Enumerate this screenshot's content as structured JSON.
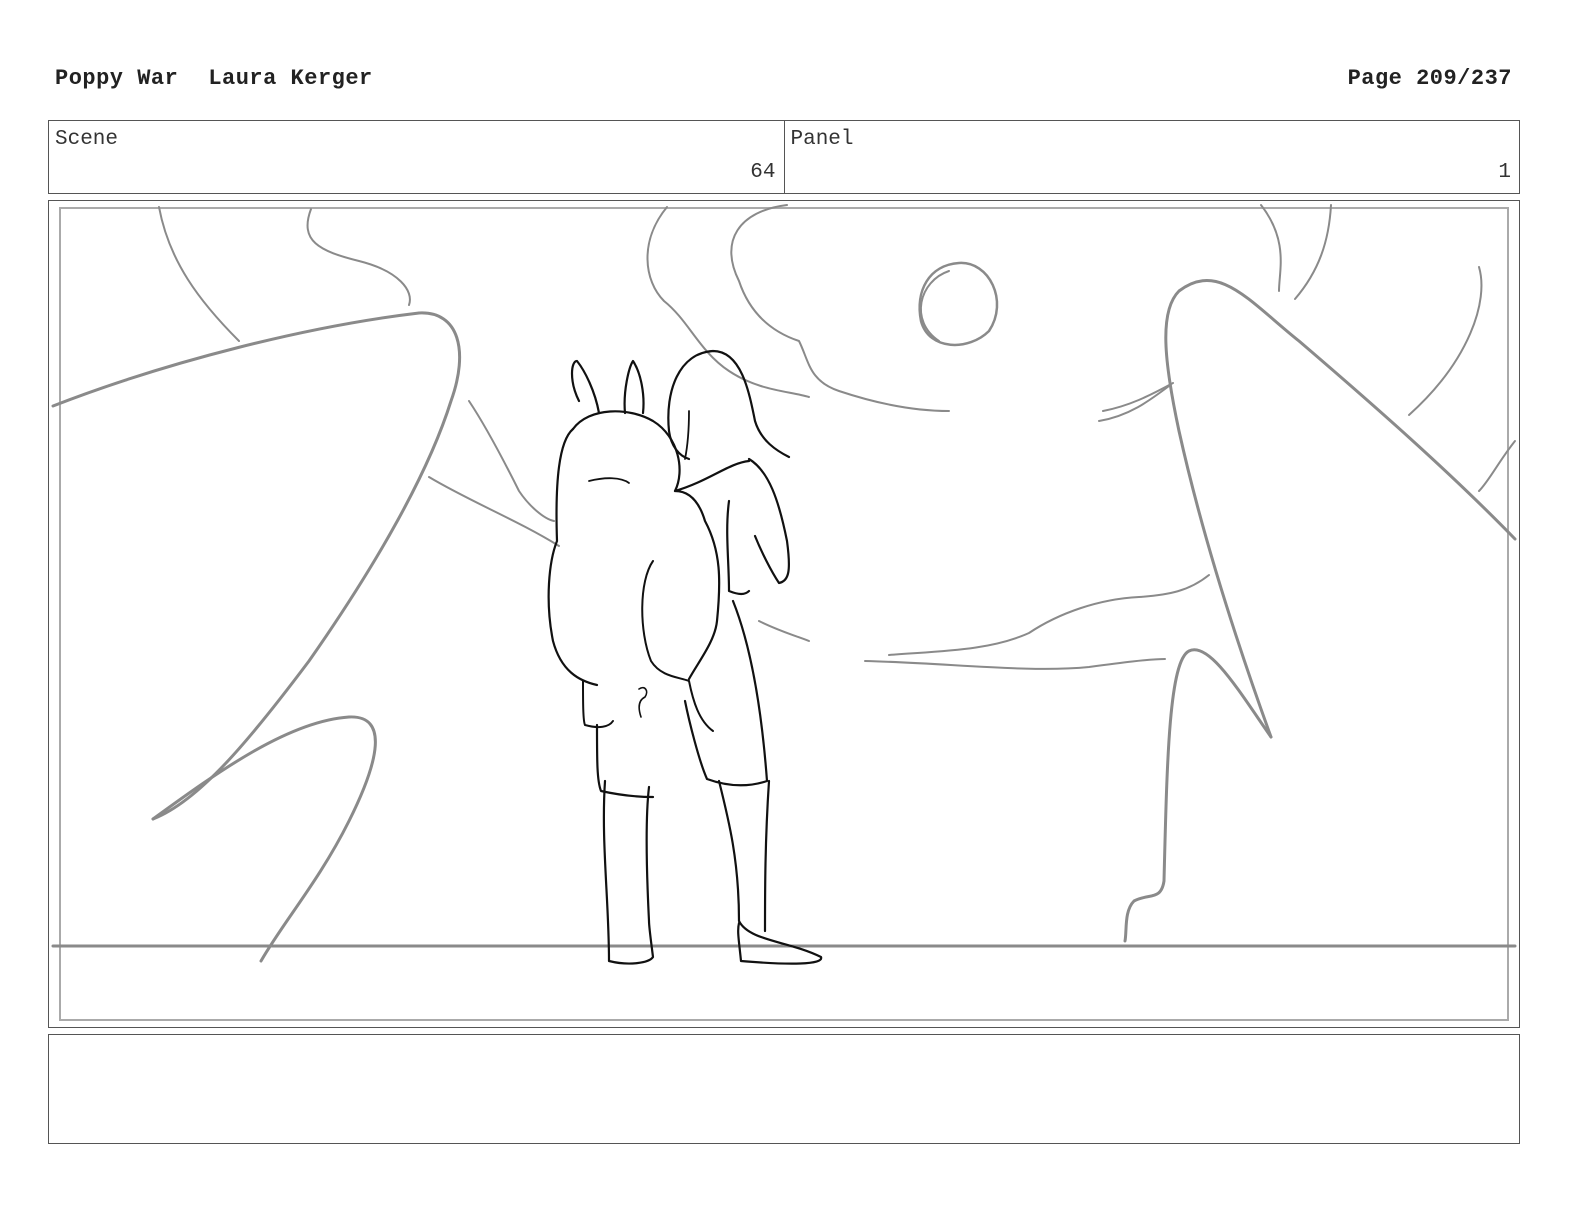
{
  "header": {
    "project": "Poppy War",
    "author": "Laura Kerger",
    "page": "Page 209/237"
  },
  "info": {
    "scene_label": "Scene",
    "scene_value": "64",
    "panel_label": "Panel",
    "panel_value": "1"
  },
  "notes": {
    "text": ""
  }
}
